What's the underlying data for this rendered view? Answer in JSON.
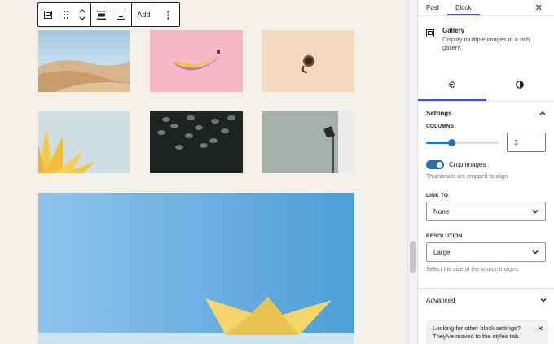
{
  "toolbar": {
    "add_label": "Add"
  },
  "sidebar": {
    "tabs": [
      {
        "label": "Post"
      },
      {
        "label": "Block"
      }
    ],
    "block": {
      "title": "Gallery",
      "description": "Display multiple images in a rich gallery."
    },
    "settings": {
      "heading": "Settings",
      "columns_label": "Columns",
      "columns_value": "3",
      "crop_label": "Crop images",
      "crop_help": "Thumbnails are cropped to align.",
      "link_to_label": "Link to",
      "link_to_value": "None",
      "resolution_label": "Resolution",
      "resolution_value": "Large",
      "resolution_help": "Select the size of the source images."
    },
    "advanced_label": "Advanced",
    "notice_text": "Looking for other block settings? They've moved to the styles tab."
  },
  "colors": {
    "accent": "#2271b1",
    "tab_indicator": "#3858e9"
  },
  "icons": {
    "gallery": "gallery-icon",
    "drag": "drag-handle-icon",
    "move": "move-up-down-icon",
    "align": "align-icon",
    "caption": "caption-icon",
    "more": "more-vertical-icon",
    "settings": "gear-icon",
    "styles": "half-circle-icon",
    "close": "close-icon",
    "chevron_up": "chevron-up-icon",
    "chevron_down": "chevron-down-icon"
  }
}
